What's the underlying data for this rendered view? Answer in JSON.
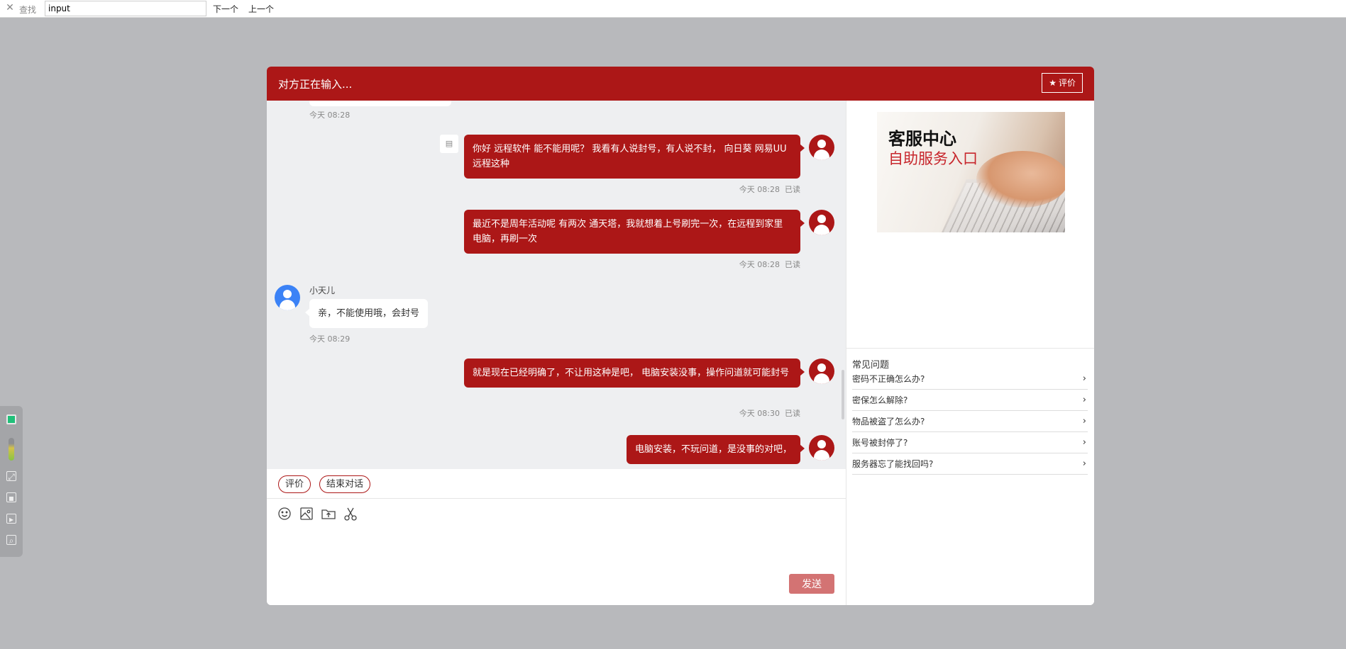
{
  "findbar": {
    "close_icon": "close-icon",
    "label": "查找",
    "value": "input",
    "next_label": "下一个",
    "prev_label": "上一个"
  },
  "chat_window": {
    "header_title": "对方正在输入...",
    "rate_button_label": "评价",
    "messages": [
      {
        "side": "left",
        "time": "今天 08:28"
      },
      {
        "side": "right",
        "text": "你好 远程软件 能不能用呢？  我看有人说封号，有人说不封，  向日葵  网易UU远程这种",
        "time": "今天 08:28",
        "status": "已读"
      },
      {
        "side": "right",
        "text": "最近不是周年活动呢  有两次 通天塔，我就想着上号刷完一次，在远程到家里电脑，再刷一次",
        "time": "今天 08:28",
        "status": "已读"
      },
      {
        "side": "left",
        "sender": "小天儿",
        "text": "亲，不能使用哦，会封号",
        "time": "今天 08:29"
      },
      {
        "side": "right",
        "text": "就是现在已经明确了，不让用这种是吧，  电脑安装没事，操作问道就可能封号",
        "time": "今天 08:30",
        "status": "已读"
      },
      {
        "side": "right",
        "text": "电脑安装，不玩问道，是没事的对吧，"
      }
    ],
    "actions": {
      "rate_label": "评价",
      "end_label": "结束对话"
    },
    "send_label": "发送"
  },
  "right_panel": {
    "banner_title": "客服中心",
    "banner_subtitle": "自助服务入口",
    "faq_title": "常见问题",
    "faq_items": [
      "密码不正确怎么办?",
      "密保怎么解除?",
      "物品被盗了怎么办?",
      "账号被封停了?",
      "服务器忘了能找回吗?"
    ]
  },
  "colors": {
    "brand_red": "#ac1717",
    "send_button": "#d37373",
    "chat_background": "#eeeff1",
    "page_background": "#b8b9bc"
  }
}
